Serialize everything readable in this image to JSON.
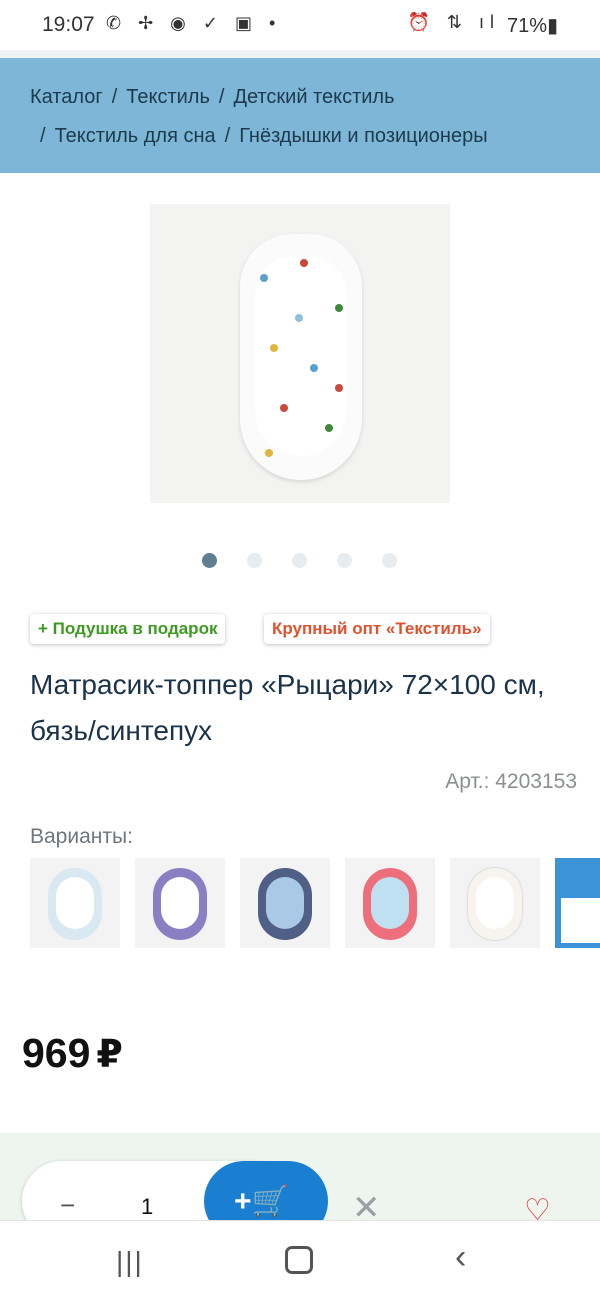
{
  "status_bar": {
    "time": "19:07",
    "left_icons": "✆ ✢ ◉ ✓ ▣ •",
    "right_icons": "⏰ ⇅ ıl",
    "battery": "71%▮"
  },
  "breadcrumb": {
    "items": [
      "Каталог",
      "Текстиль",
      "Детский текстиль",
      "Текстиль для сна",
      "Гнёздышки и позиционеры"
    ],
    "separator": "/"
  },
  "carousel": {
    "count": 5,
    "active_index": 0
  },
  "badges": {
    "gift": "+ Подушка в подарок",
    "wholesale": "Крупный опт «Текстиль»"
  },
  "product": {
    "title": "Матрасик-топпер «Рыцари» 72×100 см, бязь/синтепух",
    "article": "Арт.: 4203153",
    "price": "969",
    "currency": "₽"
  },
  "variants": {
    "label": "Варианты:",
    "items": [
      {
        "name": "light-blue",
        "color": "#d8e9f2"
      },
      {
        "name": "purple-stripes",
        "color": "#8b7fc4"
      },
      {
        "name": "navy-stripes",
        "color": "#4f5f86"
      },
      {
        "name": "pink",
        "color": "#ee6f7c"
      },
      {
        "name": "white-floral",
        "color": "#f7f3ee"
      }
    ]
  },
  "cart": {
    "minus": "−",
    "quantity": "1",
    "add_label": "+🛒",
    "remove": "✕",
    "favorite": "♡"
  },
  "nav": {
    "recent": "|||",
    "back": "‹"
  },
  "colors": {
    "breadcrumb_bg": "#7db6d6",
    "accent_blue": "#1b7fd1",
    "gift_green": "#3f9a24",
    "wholesale_red": "#e2502e"
  }
}
